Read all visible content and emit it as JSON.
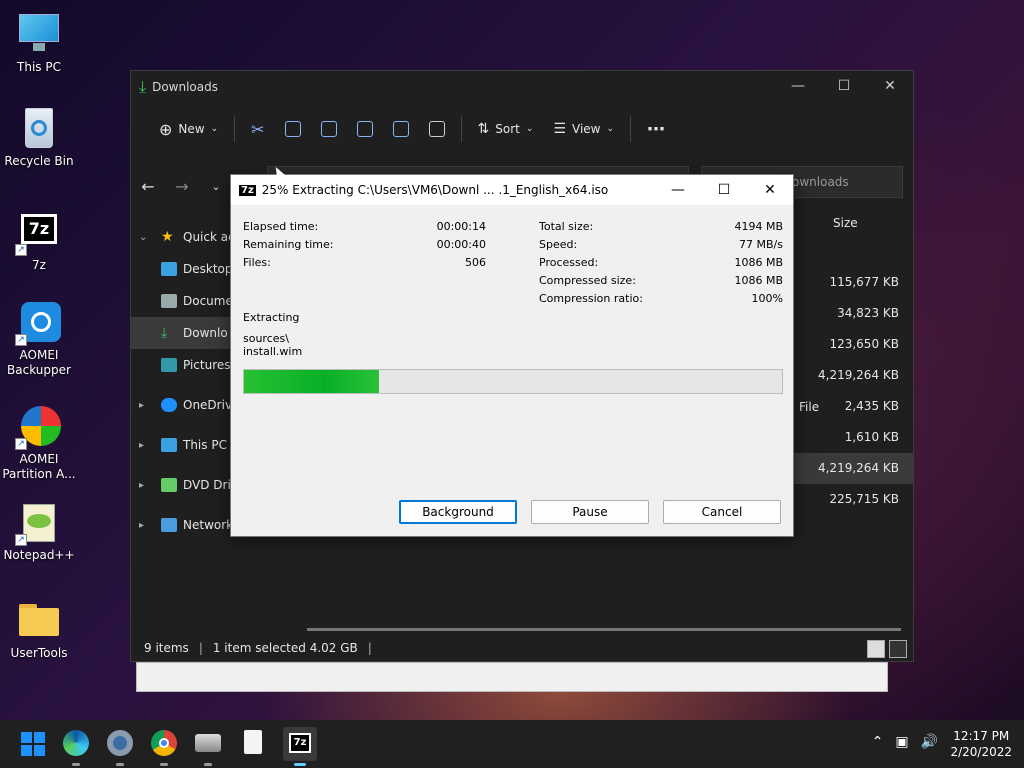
{
  "desktop": {
    "icons": [
      {
        "label": "This PC"
      },
      {
        "label": "Recycle Bin"
      },
      {
        "label": "7z"
      },
      {
        "label": "AOMEI Backupper"
      },
      {
        "label": "AOMEI Partition A..."
      },
      {
        "label": "Notepad++"
      },
      {
        "label": "UserTools"
      }
    ]
  },
  "explorer": {
    "title": "Downloads",
    "toolbar": {
      "new_label": "New",
      "sort_label": "Sort",
      "view_label": "View",
      "more_label": "⋯"
    },
    "search_placeholder": "ownloads",
    "sidebar": [
      {
        "label": "Quick acce"
      },
      {
        "label": "Desktop"
      },
      {
        "label": "Docume"
      },
      {
        "label": "Downlo"
      },
      {
        "label": "Pictures"
      },
      {
        "label": "OneDrive"
      },
      {
        "label": "This PC"
      },
      {
        "label": "DVD Drive"
      },
      {
        "label": "Network"
      }
    ],
    "column_size": "Size",
    "type_cell": "File",
    "sizes": [
      "115,677 KB",
      "34,823 KB",
      "123,650 KB",
      "4,219,264 KB",
      "2,435 KB",
      "1,610 KB",
      "4,219,264 KB",
      "225,715 KB"
    ],
    "status": {
      "items": "9 items",
      "selected": "1 item selected  4.02 GB"
    }
  },
  "dialog": {
    "title": "25% Extracting C:\\Users\\VM6\\Downl ... .1_English_x64.iso",
    "logo": "7z",
    "left": [
      {
        "label": "Elapsed time:",
        "value": "00:00:14"
      },
      {
        "label": "Remaining time:",
        "value": "00:00:40"
      },
      {
        "label": "Files:",
        "value": "506"
      }
    ],
    "right": [
      {
        "label": "Total size:",
        "value": "4194 MB"
      },
      {
        "label": "Speed:",
        "value": "77 MB/s"
      },
      {
        "label": "Processed:",
        "value": "1086 MB"
      },
      {
        "label": "Compressed size:",
        "value": "1086 MB"
      },
      {
        "label": "Compression ratio:",
        "value": "100%"
      }
    ],
    "operation": "Extracting",
    "path_line1": "sources\\",
    "path_line2": "install.wim",
    "progress_fraction": 0.25,
    "buttons": {
      "background": "Background",
      "pause": "Pause",
      "cancel": "Cancel"
    }
  },
  "taskbar": {
    "time": "12:17 PM",
    "date": "2/20/2022",
    "apps": [
      "start-icon",
      "edge-icon",
      "settings-icon",
      "chrome-icon",
      "package-icon",
      "file-icon",
      "7zip-icon"
    ]
  },
  "colors": {
    "accent": "#0078d7",
    "progress": "#06b025"
  }
}
